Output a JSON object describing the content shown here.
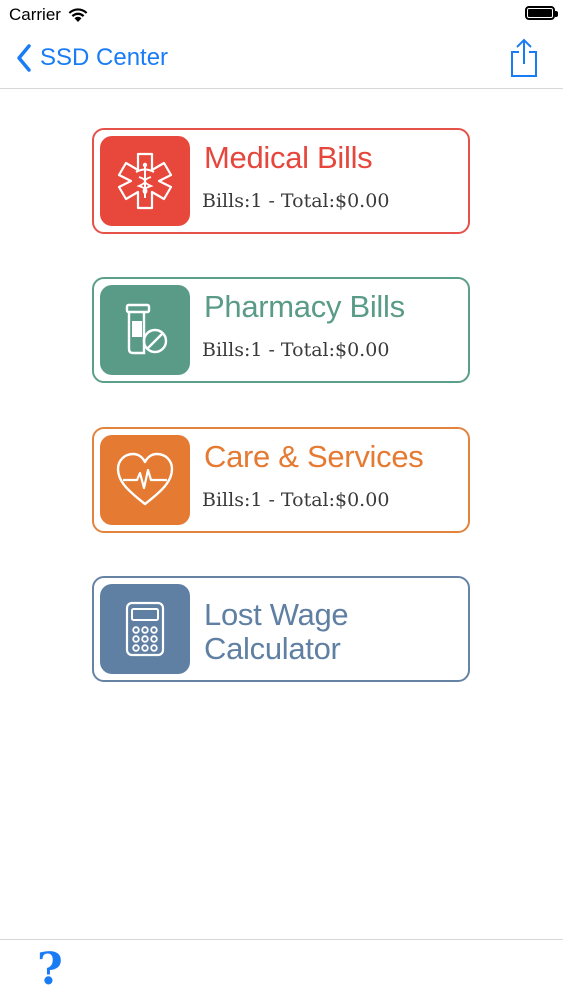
{
  "status_bar": {
    "carrier": "Carrier"
  },
  "nav": {
    "back_label": "SSD Center"
  },
  "cards": [
    {
      "title": "Medical Bills",
      "subtitle": "Bills:1 - Total:$0.00",
      "icon": "medical-caduceus-icon",
      "color": "#e8473c"
    },
    {
      "title": "Pharmacy Bills",
      "subtitle": "Bills:1 - Total:$0.00",
      "icon": "pill-bottle-icon",
      "color": "#5a9b87"
    },
    {
      "title": "Care & Services",
      "subtitle": "Bills:1 - Total:$0.00",
      "icon": "heart-pulse-icon",
      "color": "#e57a33"
    },
    {
      "title": "Lost Wage Calculator",
      "subtitle": "",
      "icon": "calculator-icon",
      "color": "#5f7fa3"
    }
  ],
  "toolbar": {
    "help_label": "?"
  },
  "colors": {
    "accent": "#1a7cf5"
  }
}
